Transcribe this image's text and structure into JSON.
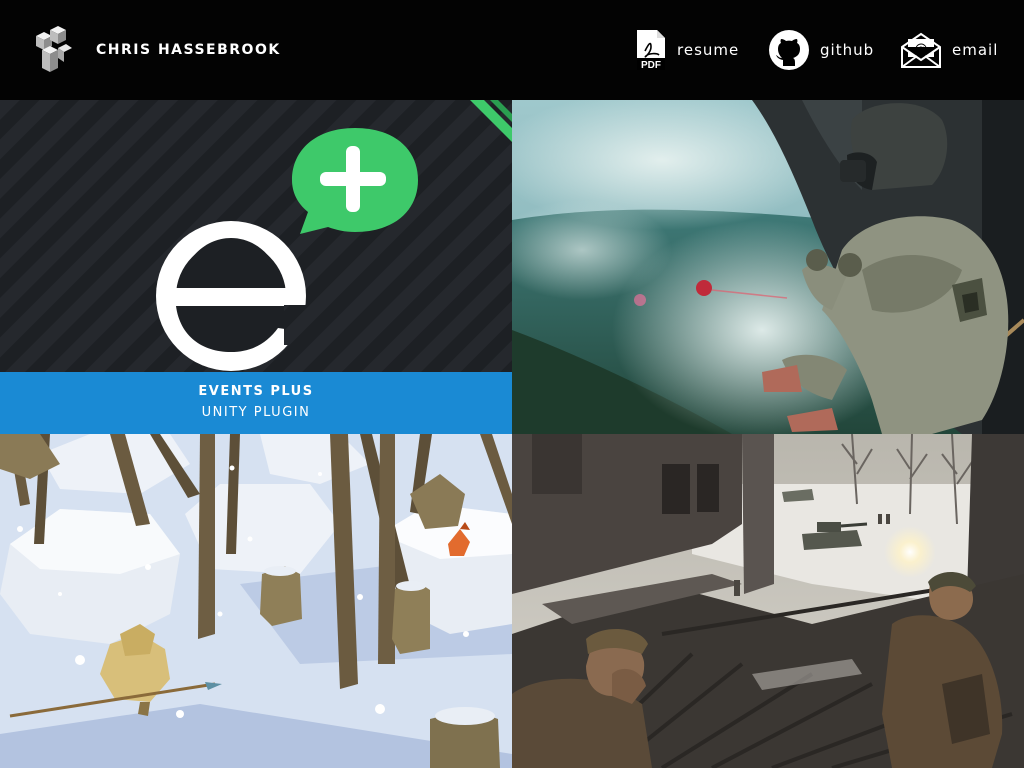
{
  "site": {
    "name": "CHRIS HASSEBROOK"
  },
  "nav": [
    {
      "label": "resume",
      "icon": "pdf-icon"
    },
    {
      "label": "github",
      "icon": "github-icon"
    },
    {
      "label": "email",
      "icon": "envelope-icon"
    }
  ],
  "tiles": [
    {
      "title": "EVENTS PLUS",
      "subtitle": "UNITY PLUGIN",
      "scene": "events-plus-logo",
      "caption_color": "#1a8ad4",
      "accent": "#3ec96a"
    },
    {
      "scene": "soldier-rappelling-helicopter"
    },
    {
      "scene": "low-poly-snow-forest"
    },
    {
      "scene": "winter-war-battlefield"
    }
  ]
}
